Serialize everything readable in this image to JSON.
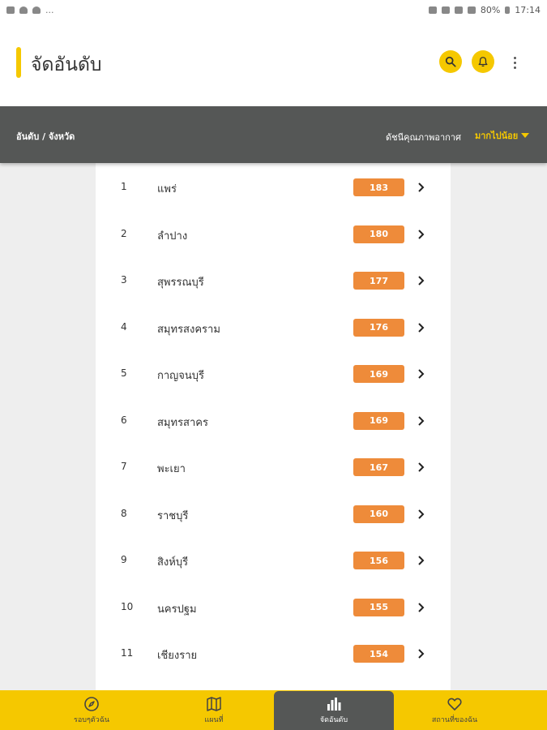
{
  "status_bar": {
    "left_dots": "...",
    "battery": "80%",
    "time": "17:14"
  },
  "app": {
    "title": "จัดอันดับ",
    "accent_color": "#f5c800",
    "icons": [
      "search-icon",
      "bell-icon",
      "more-vert-icon"
    ]
  },
  "subheader": {
    "breadcrumb": "อันดับ / จังหวัด",
    "index_label": "ดัชนีคุณภาพอากาศ",
    "sort_label": "มากไปน้อย"
  },
  "ranking": [
    {
      "rank": "1",
      "province": "แพร่",
      "aqi": "183"
    },
    {
      "rank": "2",
      "province": "ลำปาง",
      "aqi": "180"
    },
    {
      "rank": "3",
      "province": "สุพรรณบุรี",
      "aqi": "177"
    },
    {
      "rank": "4",
      "province": "สมุทรสงคราม",
      "aqi": "176"
    },
    {
      "rank": "5",
      "province": "กาญจนบุรี",
      "aqi": "169"
    },
    {
      "rank": "6",
      "province": "สมุทรสาคร",
      "aqi": "169"
    },
    {
      "rank": "7",
      "province": "พะเยา",
      "aqi": "167"
    },
    {
      "rank": "8",
      "province": "ราชบุรี",
      "aqi": "160"
    },
    {
      "rank": "9",
      "province": "สิงห์บุรี",
      "aqi": "156"
    },
    {
      "rank": "10",
      "province": "นครปฐม",
      "aqi": "155"
    },
    {
      "rank": "11",
      "province": "เชียงราย",
      "aqi": "154"
    }
  ],
  "badge_color": "#ee8b3a",
  "bottom_nav": [
    {
      "label": "รอบๆตัวฉัน",
      "icon": "compass-icon",
      "active": false
    },
    {
      "label": "แผนที่",
      "icon": "map-icon",
      "active": false
    },
    {
      "label": "จัดอันดับ",
      "icon": "bar-chart-icon",
      "active": true
    },
    {
      "label": "สถานที่ของฉัน",
      "icon": "heart-icon",
      "active": false
    }
  ]
}
